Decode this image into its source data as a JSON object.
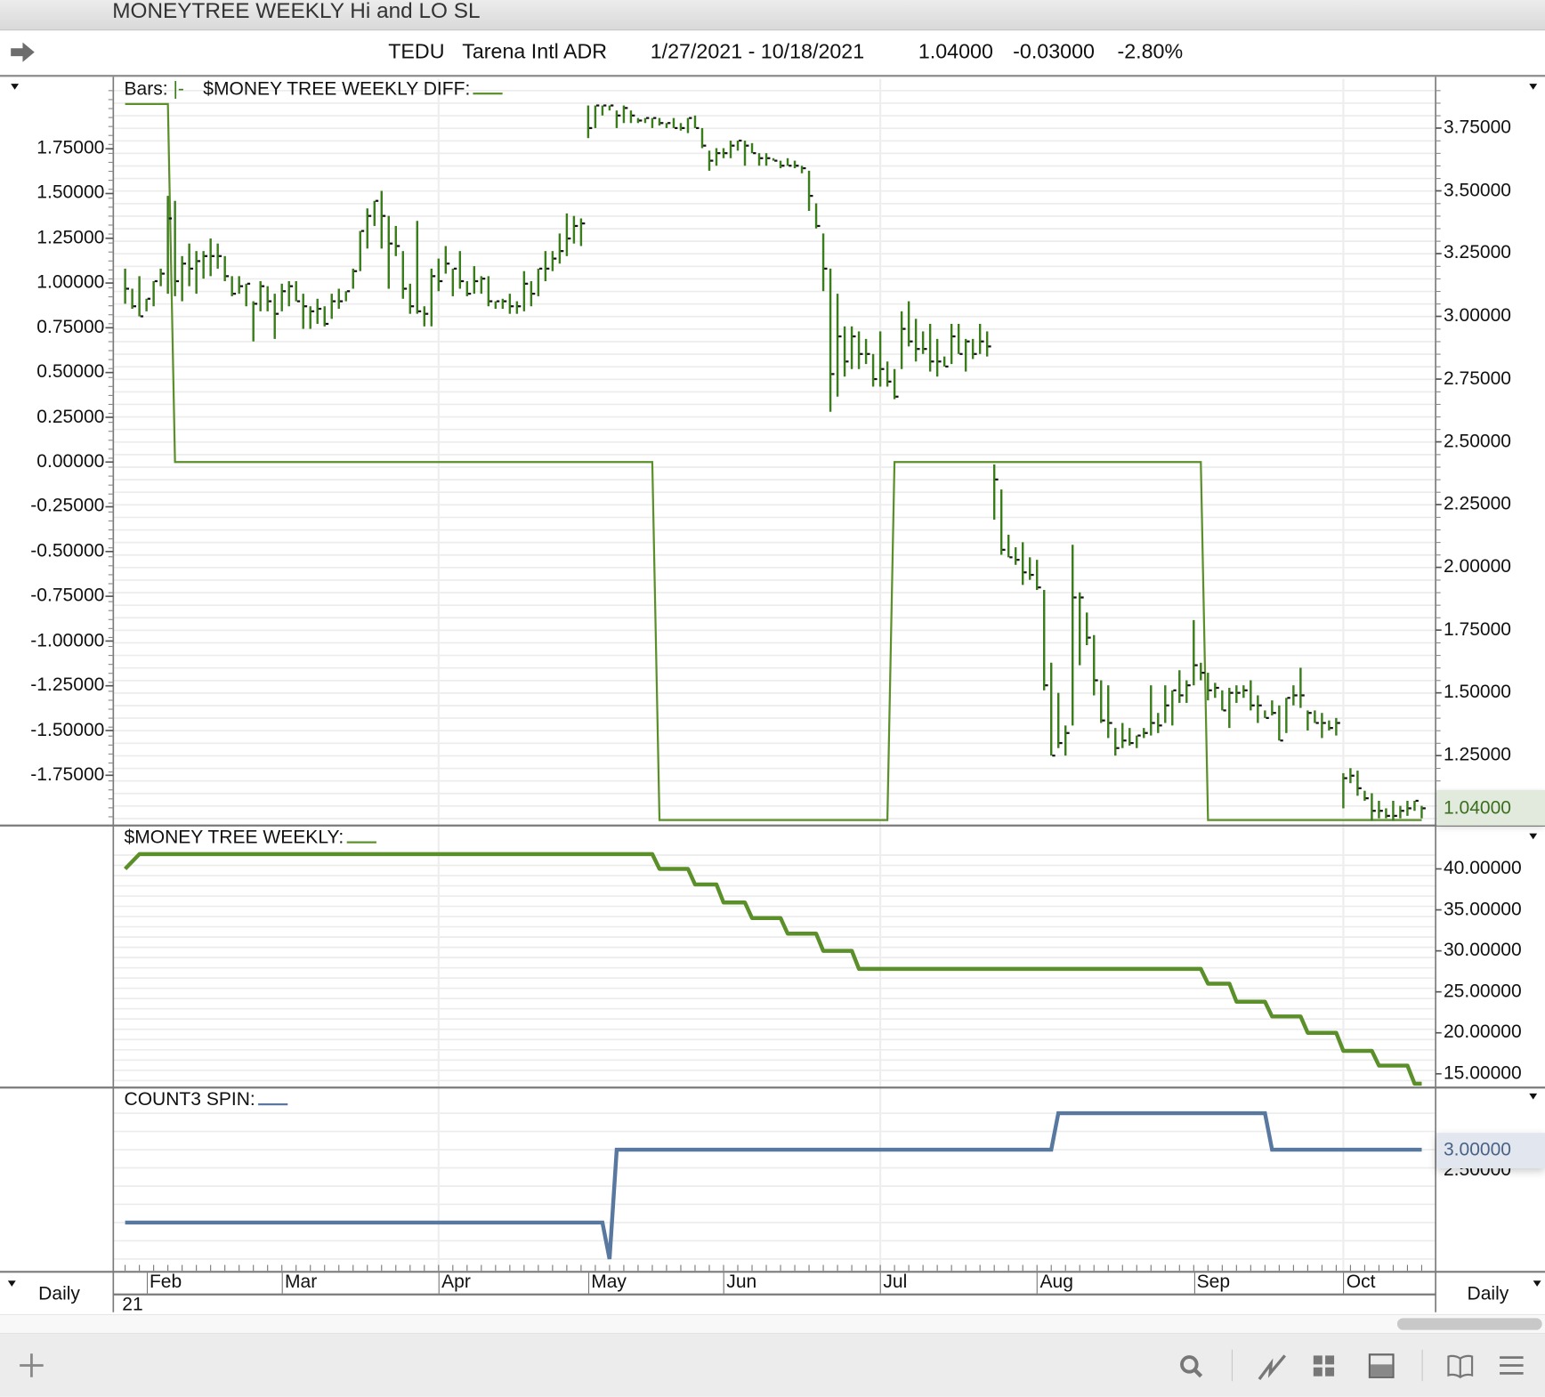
{
  "window_title": "MONEYTREE WEEKLY Hi and LO SL",
  "header": {
    "symbol": "TEDU",
    "name": "Tarena Intl ADR",
    "date_range": "1/27/2021 - 10/18/2021",
    "last": "1.04000",
    "change": "-0.03000",
    "change_pct": "-2.80%"
  },
  "panes": {
    "main": {
      "bars_label": "Bars:",
      "bars_glyph": "|-",
      "title": "$MONEY TREE WEEKLY DIFF:",
      "last_price_label": "1.04000"
    },
    "money_tree": {
      "title": "$MONEY TREE WEEKLY:"
    },
    "count3": {
      "title": "COUNT3 SPIN:",
      "last_value_label": "3.00000"
    }
  },
  "periodicity_left": "Daily",
  "periodicity_right": "Daily",
  "year_label": "21",
  "colors": {
    "bars": "#3b7d1d",
    "diff": "#5b8f2a",
    "money_tree": "#5b8f2a",
    "count3": "#5878a0",
    "last_price_bg": "#e1eadc",
    "count3_bg": "#e2e7ef"
  },
  "chart_data": [
    {
      "type": "ohlc",
      "title": "TEDU price bars",
      "axis": "right",
      "ylim": [
        0.95,
        3.85
      ],
      "yticks": [
        "3.75000",
        "3.50000",
        "3.25000",
        "3.00000",
        "2.75000",
        "2.50000",
        "2.25000",
        "2.00000",
        "1.75000",
        "1.50000",
        "1.25000"
      ],
      "ytick_values": [
        3.75,
        3.5,
        3.25,
        3.0,
        2.75,
        2.5,
        2.25,
        2.0,
        1.75,
        1.5,
        1.25
      ],
      "bars_hlc": [
        [
          3.19,
          3.05,
          3.11
        ],
        [
          3.11,
          3.03,
          3.04
        ],
        [
          3.16,
          3.0,
          3.0
        ],
        [
          3.07,
          3.02,
          3.07
        ],
        [
          3.14,
          3.04,
          3.14
        ],
        [
          3.19,
          3.12,
          3.17
        ],
        [
          3.48,
          3.09,
          3.39
        ],
        [
          3.46,
          3.08,
          3.14
        ],
        [
          3.24,
          3.06,
          3.21
        ],
        [
          3.29,
          3.12,
          3.19
        ],
        [
          3.26,
          3.09,
          3.22
        ],
        [
          3.26,
          3.15,
          3.24
        ],
        [
          3.31,
          3.16,
          3.24
        ],
        [
          3.29,
          3.19,
          3.24
        ],
        [
          3.24,
          3.14,
          3.16
        ],
        [
          3.16,
          3.08,
          3.09
        ],
        [
          3.16,
          3.09,
          3.12
        ],
        [
          3.13,
          3.04,
          3.13
        ],
        [
          3.06,
          2.9,
          3.05
        ],
        [
          3.14,
          3.02,
          3.12
        ],
        [
          3.12,
          3.02,
          3.06
        ],
        [
          3.09,
          2.91,
          3.01
        ],
        [
          3.13,
          3.02,
          3.1
        ],
        [
          3.14,
          3.04,
          3.12
        ],
        [
          3.14,
          3.06,
          3.06
        ],
        [
          3.09,
          2.95,
          3.04
        ],
        [
          3.04,
          2.95,
          3.02
        ],
        [
          3.07,
          2.97,
          3.03
        ],
        [
          3.04,
          2.96,
          2.97
        ],
        [
          3.09,
          2.99,
          3.06
        ],
        [
          3.11,
          3.03,
          3.06
        ],
        [
          3.1,
          3.06,
          3.1
        ],
        [
          3.19,
          3.11,
          3.18
        ],
        [
          3.34,
          3.18,
          3.34
        ],
        [
          3.43,
          3.27,
          3.4
        ],
        [
          3.46,
          3.36,
          3.46
        ],
        [
          3.5,
          3.27,
          3.4
        ],
        [
          3.4,
          3.11,
          3.29
        ],
        [
          3.36,
          3.24,
          3.28
        ],
        [
          3.26,
          3.07,
          3.11
        ],
        [
          3.13,
          3.01,
          3.04
        ],
        [
          3.38,
          3.01,
          3.02
        ],
        [
          3.04,
          2.96,
          3.01
        ],
        [
          3.19,
          2.96,
          3.16
        ],
        [
          3.23,
          3.1,
          3.14
        ],
        [
          3.28,
          3.17,
          3.21
        ],
        [
          3.19,
          3.08,
          3.19
        ],
        [
          3.26,
          3.11,
          3.14
        ],
        [
          3.14,
          3.08,
          3.09
        ],
        [
          3.2,
          3.09,
          3.14
        ],
        [
          3.16,
          3.09,
          3.15
        ],
        [
          3.16,
          3.04,
          3.06
        ],
        [
          3.06,
          3.03,
          3.06
        ],
        [
          3.07,
          3.03,
          3.06
        ],
        [
          3.09,
          3.01,
          3.04
        ],
        [
          3.06,
          3.01,
          3.04
        ],
        [
          3.18,
          3.02,
          3.13
        ],
        [
          3.14,
          3.04,
          3.09
        ],
        [
          3.19,
          3.08,
          3.19
        ],
        [
          3.26,
          3.14,
          3.19
        ],
        [
          3.26,
          3.18,
          3.23
        ],
        [
          3.33,
          3.21,
          3.26
        ],
        [
          3.41,
          3.24,
          3.31
        ],
        [
          3.4,
          3.29,
          3.36
        ],
        [
          3.39,
          3.28,
          3.37
        ],
        [
          3.84,
          3.71,
          3.75
        ],
        [
          3.84,
          3.75,
          3.84
        ],
        [
          3.84,
          3.8,
          3.84
        ],
        [
          3.84,
          3.82,
          3.84
        ],
        [
          3.82,
          3.75,
          3.8
        ],
        [
          3.84,
          3.77,
          3.83
        ],
        [
          3.82,
          3.77,
          3.8
        ],
        [
          3.79,
          3.77,
          3.78
        ],
        [
          3.79,
          3.77,
          3.79
        ],
        [
          3.79,
          3.75,
          3.79
        ],
        [
          3.79,
          3.76,
          3.77
        ],
        [
          3.77,
          3.75,
          3.77
        ],
        [
          3.79,
          3.75,
          3.75
        ],
        [
          3.77,
          3.74,
          3.75
        ],
        [
          3.79,
          3.73,
          3.79
        ],
        [
          3.8,
          3.75,
          3.75
        ],
        [
          3.75,
          3.67,
          3.68
        ],
        [
          3.66,
          3.58,
          3.62
        ],
        [
          3.67,
          3.6,
          3.65
        ],
        [
          3.67,
          3.63,
          3.65
        ],
        [
          3.7,
          3.63,
          3.68
        ],
        [
          3.7,
          3.66,
          3.7
        ],
        [
          3.7,
          3.6,
          3.68
        ],
        [
          3.69,
          3.65,
          3.65
        ],
        [
          3.65,
          3.6,
          3.63
        ],
        [
          3.65,
          3.6,
          3.63
        ],
        [
          3.63,
          3.62,
          3.62
        ],
        [
          3.62,
          3.59,
          3.6
        ],
        [
          3.63,
          3.6,
          3.6
        ],
        [
          3.62,
          3.59,
          3.6
        ],
        [
          3.6,
          3.57,
          3.59
        ],
        [
          3.58,
          3.42,
          3.48
        ],
        [
          3.45,
          3.35,
          3.36
        ],
        [
          3.33,
          3.1,
          3.19
        ],
        [
          3.19,
          2.62,
          2.77
        ],
        [
          3.09,
          2.68,
          2.92
        ],
        [
          2.96,
          2.76,
          2.82
        ],
        [
          2.96,
          2.79,
          2.92
        ],
        [
          2.94,
          2.79,
          2.85
        ],
        [
          2.91,
          2.81,
          2.85
        ],
        [
          2.85,
          2.72,
          2.75
        ],
        [
          2.94,
          2.72,
          2.79
        ],
        [
          2.82,
          2.72,
          2.74
        ],
        [
          2.79,
          2.67,
          2.68
        ],
        [
          3.02,
          2.79,
          2.95
        ],
        [
          3.06,
          2.88,
          2.9
        ],
        [
          2.99,
          2.82,
          2.87
        ],
        [
          2.94,
          2.85,
          2.87
        ],
        [
          2.97,
          2.78,
          2.82
        ],
        [
          2.91,
          2.76,
          2.82
        ],
        [
          2.84,
          2.8,
          2.8
        ],
        [
          2.97,
          2.81,
          2.92
        ],
        [
          2.97,
          2.85,
          2.85
        ],
        [
          2.91,
          2.78,
          2.9
        ],
        [
          2.91,
          2.83,
          2.85
        ],
        [
          2.97,
          2.85,
          2.9
        ],
        [
          2.94,
          2.84,
          2.88
        ],
        [
          2.41,
          2.19,
          2.35
        ],
        [
          2.31,
          2.05,
          2.07
        ],
        [
          2.13,
          2.04,
          2.04
        ],
        [
          2.08,
          2.01,
          2.03
        ],
        [
          2.1,
          1.93,
          1.98
        ],
        [
          2.04,
          1.95,
          1.97
        ],
        [
          2.03,
          1.91,
          1.92
        ],
        [
          1.91,
          1.51,
          1.53
        ],
        [
          1.62,
          1.25,
          1.25
        ],
        [
          1.5,
          1.28,
          1.3
        ],
        [
          1.37,
          1.25,
          1.34
        ],
        [
          2.09,
          1.37,
          1.88
        ],
        [
          1.9,
          1.61,
          1.88
        ],
        [
          1.82,
          1.69,
          1.72
        ],
        [
          1.73,
          1.49,
          1.55
        ],
        [
          1.55,
          1.38,
          1.39
        ],
        [
          1.53,
          1.32,
          1.38
        ],
        [
          1.36,
          1.25,
          1.28
        ],
        [
          1.38,
          1.28,
          1.31
        ],
        [
          1.36,
          1.29,
          1.3
        ],
        [
          1.33,
          1.28,
          1.33
        ],
        [
          1.36,
          1.32,
          1.34
        ],
        [
          1.53,
          1.33,
          1.38
        ],
        [
          1.42,
          1.34,
          1.37
        ],
        [
          1.53,
          1.38,
          1.45
        ],
        [
          1.51,
          1.37,
          1.51
        ],
        [
          1.59,
          1.46,
          1.49
        ],
        [
          1.55,
          1.46,
          1.53
        ],
        [
          1.79,
          1.53,
          1.61
        ],
        [
          1.62,
          1.55,
          1.58
        ],
        [
          1.58,
          1.47,
          1.51
        ],
        [
          1.54,
          1.48,
          1.52
        ],
        [
          1.51,
          1.43,
          1.43
        ],
        [
          1.52,
          1.36,
          1.5
        ],
        [
          1.53,
          1.46,
          1.5
        ],
        [
          1.53,
          1.48,
          1.51
        ],
        [
          1.55,
          1.43,
          1.45
        ],
        [
          1.49,
          1.38,
          1.45
        ],
        [
          1.43,
          1.4,
          1.4
        ],
        [
          1.47,
          1.41,
          1.42
        ],
        [
          1.45,
          1.31,
          1.31
        ],
        [
          1.48,
          1.34,
          1.48
        ],
        [
          1.53,
          1.45,
          1.49
        ],
        [
          1.6,
          1.44,
          1.49
        ],
        [
          1.43,
          1.35,
          1.42
        ],
        [
          1.43,
          1.38,
          1.38
        ],
        [
          1.42,
          1.32,
          1.38
        ],
        [
          1.39,
          1.35,
          1.36
        ],
        [
          1.4,
          1.33,
          1.38
        ],
        [
          1.18,
          1.04,
          1.16
        ],
        [
          1.2,
          1.14,
          1.17
        ],
        [
          1.19,
          1.09,
          1.12
        ],
        [
          1.11,
          1.07,
          1.08
        ],
        [
          1.1,
          0.99,
          1.03
        ],
        [
          1.07,
          1.0,
          1.03
        ],
        [
          1.04,
          1.0,
          1.01
        ],
        [
          1.07,
          0.99,
          1.01
        ],
        [
          1.05,
          1.0,
          1.03
        ],
        [
          1.07,
          1.01,
          1.04
        ],
        [
          1.07,
          1.03,
          1.07
        ],
        [
          1.05,
          1.0,
          1.04
        ]
      ]
    },
    {
      "type": "line",
      "title": "$MONEY TREE WEEKLY DIFF",
      "axis": "left",
      "ylim": [
        -2.05,
        2.05
      ],
      "yticks": [
        "1.75000",
        "1.50000",
        "1.25000",
        "1.00000",
        "0.75000",
        "0.50000",
        "0.25000",
        "0.00000",
        "-0.25000",
        "-0.50000",
        "-0.75000",
        "-1.00000",
        "-1.25000",
        "-1.50000",
        "-1.75000"
      ],
      "ytick_values": [
        1.75,
        1.5,
        1.25,
        1.0,
        0.75,
        0.5,
        0.25,
        0,
        -0.25,
        -0.5,
        -0.75,
        -1.0,
        -1.25,
        -1.5,
        -1.75
      ],
      "points": [
        [
          0,
          2
        ],
        [
          6,
          2
        ],
        [
          7,
          0
        ],
        [
          74,
          0
        ],
        [
          75,
          -2
        ],
        [
          107,
          -2
        ],
        [
          108,
          0
        ],
        [
          151,
          0
        ],
        [
          152,
          -2
        ],
        [
          182,
          -2
        ]
      ]
    },
    {
      "type": "line",
      "title": "$MONEY TREE WEEKLY",
      "axis": "right",
      "ylim": [
        13.5,
        42.5
      ],
      "yticks": [
        "40.00000",
        "35.00000",
        "30.00000",
        "25.00000",
        "20.00000",
        "15.00000"
      ],
      "ytick_values": [
        40,
        35,
        30,
        25,
        20,
        15
      ],
      "points": [
        [
          0,
          40
        ],
        [
          2,
          41.8
        ],
        [
          74,
          41.8
        ],
        [
          75,
          40
        ],
        [
          79,
          40
        ],
        [
          80,
          38.1
        ],
        [
          83,
          38.1
        ],
        [
          84,
          35.9
        ],
        [
          87,
          35.9
        ],
        [
          88,
          34
        ],
        [
          92,
          34
        ],
        [
          93,
          32.1
        ],
        [
          97,
          32.1
        ],
        [
          98,
          30
        ],
        [
          102,
          30
        ],
        [
          103,
          27.8
        ],
        [
          151,
          27.8
        ],
        [
          152,
          26
        ],
        [
          155,
          26
        ],
        [
          156,
          23.8
        ],
        [
          160,
          23.8
        ],
        [
          161,
          22
        ],
        [
          165,
          22
        ],
        [
          166,
          20
        ],
        [
          170,
          20
        ],
        [
          171,
          17.8
        ],
        [
          175,
          17.8
        ],
        [
          176,
          16
        ],
        [
          180,
          16
        ],
        [
          181,
          13.8
        ],
        [
          182,
          13.8
        ]
      ]
    },
    {
      "type": "line",
      "title": "COUNT3 SPIN",
      "axis": "right",
      "ylim": [
        0,
        4.2
      ],
      "yticks": [
        "2.50000"
      ],
      "ytick_values": [
        2.5
      ],
      "points": [
        [
          0,
          1
        ],
        [
          67,
          1
        ],
        [
          68,
          0
        ],
        [
          69,
          3
        ],
        [
          130,
          3
        ],
        [
          131,
          4
        ],
        [
          160,
          4
        ],
        [
          161,
          3
        ],
        [
          182,
          3
        ]
      ]
    }
  ],
  "x_axis": {
    "months": [
      {
        "label": "Feb",
        "index": 3
      },
      {
        "label": "Mar",
        "index": 22
      },
      {
        "label": "Apr",
        "index": 44
      },
      {
        "label": "May",
        "index": 65
      },
      {
        "label": "Jun",
        "index": 84
      },
      {
        "label": "Jul",
        "index": 106
      },
      {
        "label": "Aug",
        "index": 128
      },
      {
        "label": "Sep",
        "index": 150
      },
      {
        "label": "Oct",
        "index": 171
      }
    ]
  },
  "toolbar": {
    "icons": [
      "plus-icon",
      "search-icon",
      "line-chart-icon",
      "grid-icon",
      "panel-layout-icon",
      "book-icon",
      "menu-icon"
    ]
  }
}
